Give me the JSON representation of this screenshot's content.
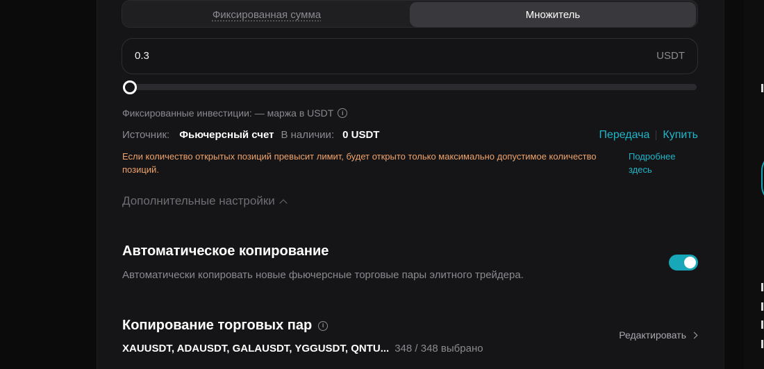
{
  "mode_tabs": [
    {
      "label": "Фиксированная сумма",
      "active": false
    },
    {
      "label": "Множитель",
      "active": true
    }
  ],
  "amount": {
    "value": "0.3",
    "unit": "USDT"
  },
  "slider": {
    "level": 0
  },
  "fixed_investment_text": "Фиксированные инвестиции: — маржа в USDT",
  "source": {
    "label": "Источник:",
    "value": "Фьючерсный счет",
    "available_label": "В наличии:",
    "available_value": "0 USDT"
  },
  "links": {
    "transfer": "Передача",
    "buy": "Купить"
  },
  "warning_text": "Если количество открытых позиций превысит лимит, будет открыто только максимально допустимое количество позиций.",
  "more_link": "Подробнее здесь",
  "advanced_settings": "Дополнительные настройки",
  "auto_copy": {
    "title": "Автоматическое копирование",
    "description": "Автоматически копировать новые фьючерсные торговые пары элитного трейдера.",
    "enabled": true
  },
  "pairs": {
    "title": "Копирование торговых пар",
    "list": "XAUUSDT, ADAUSDT, GALAUSDT, YGGUSDT, QNTU...",
    "count": "348 / 348 выбрано",
    "edit_label": "Редактировать"
  },
  "colors": {
    "accent": "#17a7b8",
    "link": "#1fb6c9",
    "warning": "#f0a36a",
    "background": "#151517"
  }
}
